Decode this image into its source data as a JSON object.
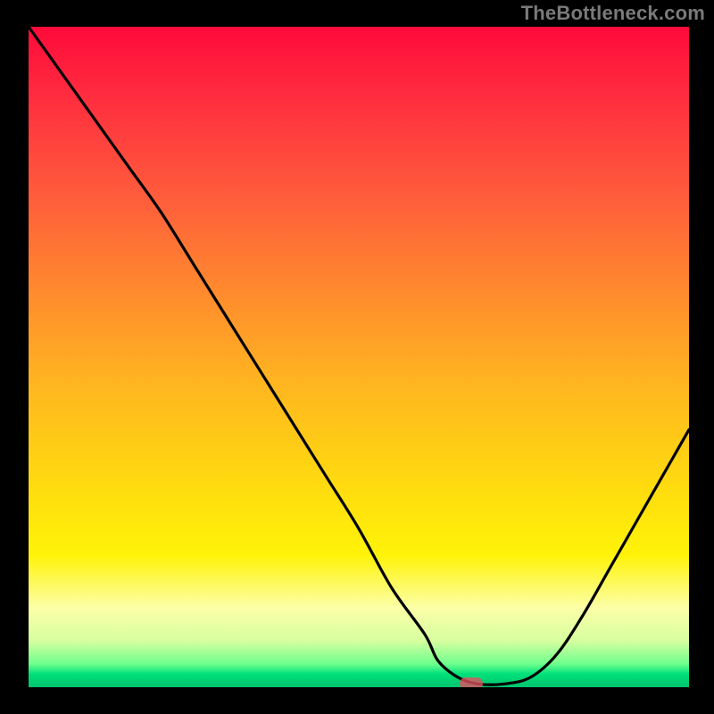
{
  "watermark": "TheBottleneck.com",
  "colors": {
    "frame": "#000000",
    "curve": "#000000",
    "marker": "rgba(229,80,96,0.78)"
  },
  "chart_data": {
    "type": "line",
    "title": "",
    "xlabel": "",
    "ylabel": "",
    "xlim": [
      0,
      100
    ],
    "ylim": [
      0,
      100
    ],
    "grid": false,
    "legend": false,
    "series": [
      {
        "name": "bottleneck-curve",
        "x": [
          0,
          5,
          10,
          15,
          20,
          25,
          30,
          35,
          40,
          45,
          50,
          55,
          60,
          62,
          65,
          68,
          72,
          76,
          80,
          84,
          88,
          92,
          96,
          100
        ],
        "values": [
          100,
          93,
          86,
          79,
          72,
          64,
          56,
          48,
          40,
          32,
          24,
          15,
          8,
          4,
          1.5,
          0.5,
          0.5,
          1.5,
          5,
          11,
          18,
          25,
          32,
          39
        ]
      }
    ],
    "marker": {
      "x": 67,
      "y": 0.5
    },
    "annotations": []
  }
}
